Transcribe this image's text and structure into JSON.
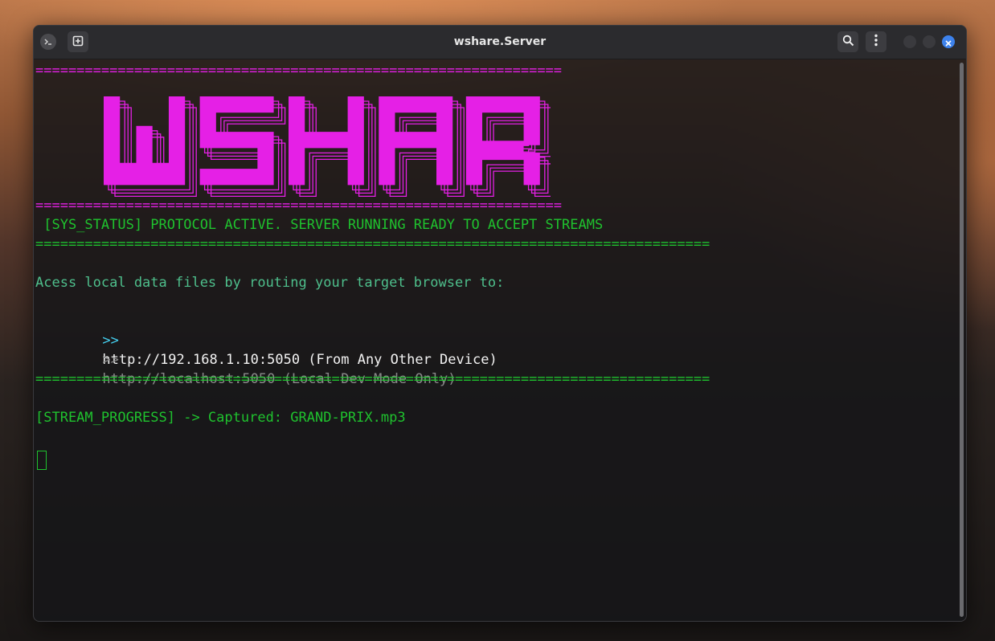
{
  "window": {
    "title": "wshare.Server"
  },
  "terminal": {
    "rule_short": "================================================================",
    "rule_long": "==================================================================================",
    "banner": "WSHARE",
    "status_line": " [SYS_STATUS] PROTOCOL ACTIVE. SERVER RUNNING READY TO ACCEPT STREAMS",
    "access_prompt": "Acess local data files by routing your target browser to:",
    "route_marker": ">>",
    "url_network": "http://192.168.1.10:5050 (From Any Other Device)",
    "url_local": "http://localhost:5050 (Local Dev Mode Only)",
    "progress_line": "[STREAM_PROGRESS] -> Captured: GRAND-PRIX.mp3"
  },
  "colors": {
    "banner": "#e520e6",
    "status": "#1fc22e",
    "text": "#4ebf8c",
    "accent": "#45d0f0"
  },
  "icons": {
    "terminal_app": "terminal-icon",
    "new_tab": "new-tab-icon",
    "search": "search-icon",
    "menu": "kebab-menu-icon",
    "minimize": "minimize-icon",
    "maximize": "maximize-icon",
    "close": "close-icon"
  }
}
